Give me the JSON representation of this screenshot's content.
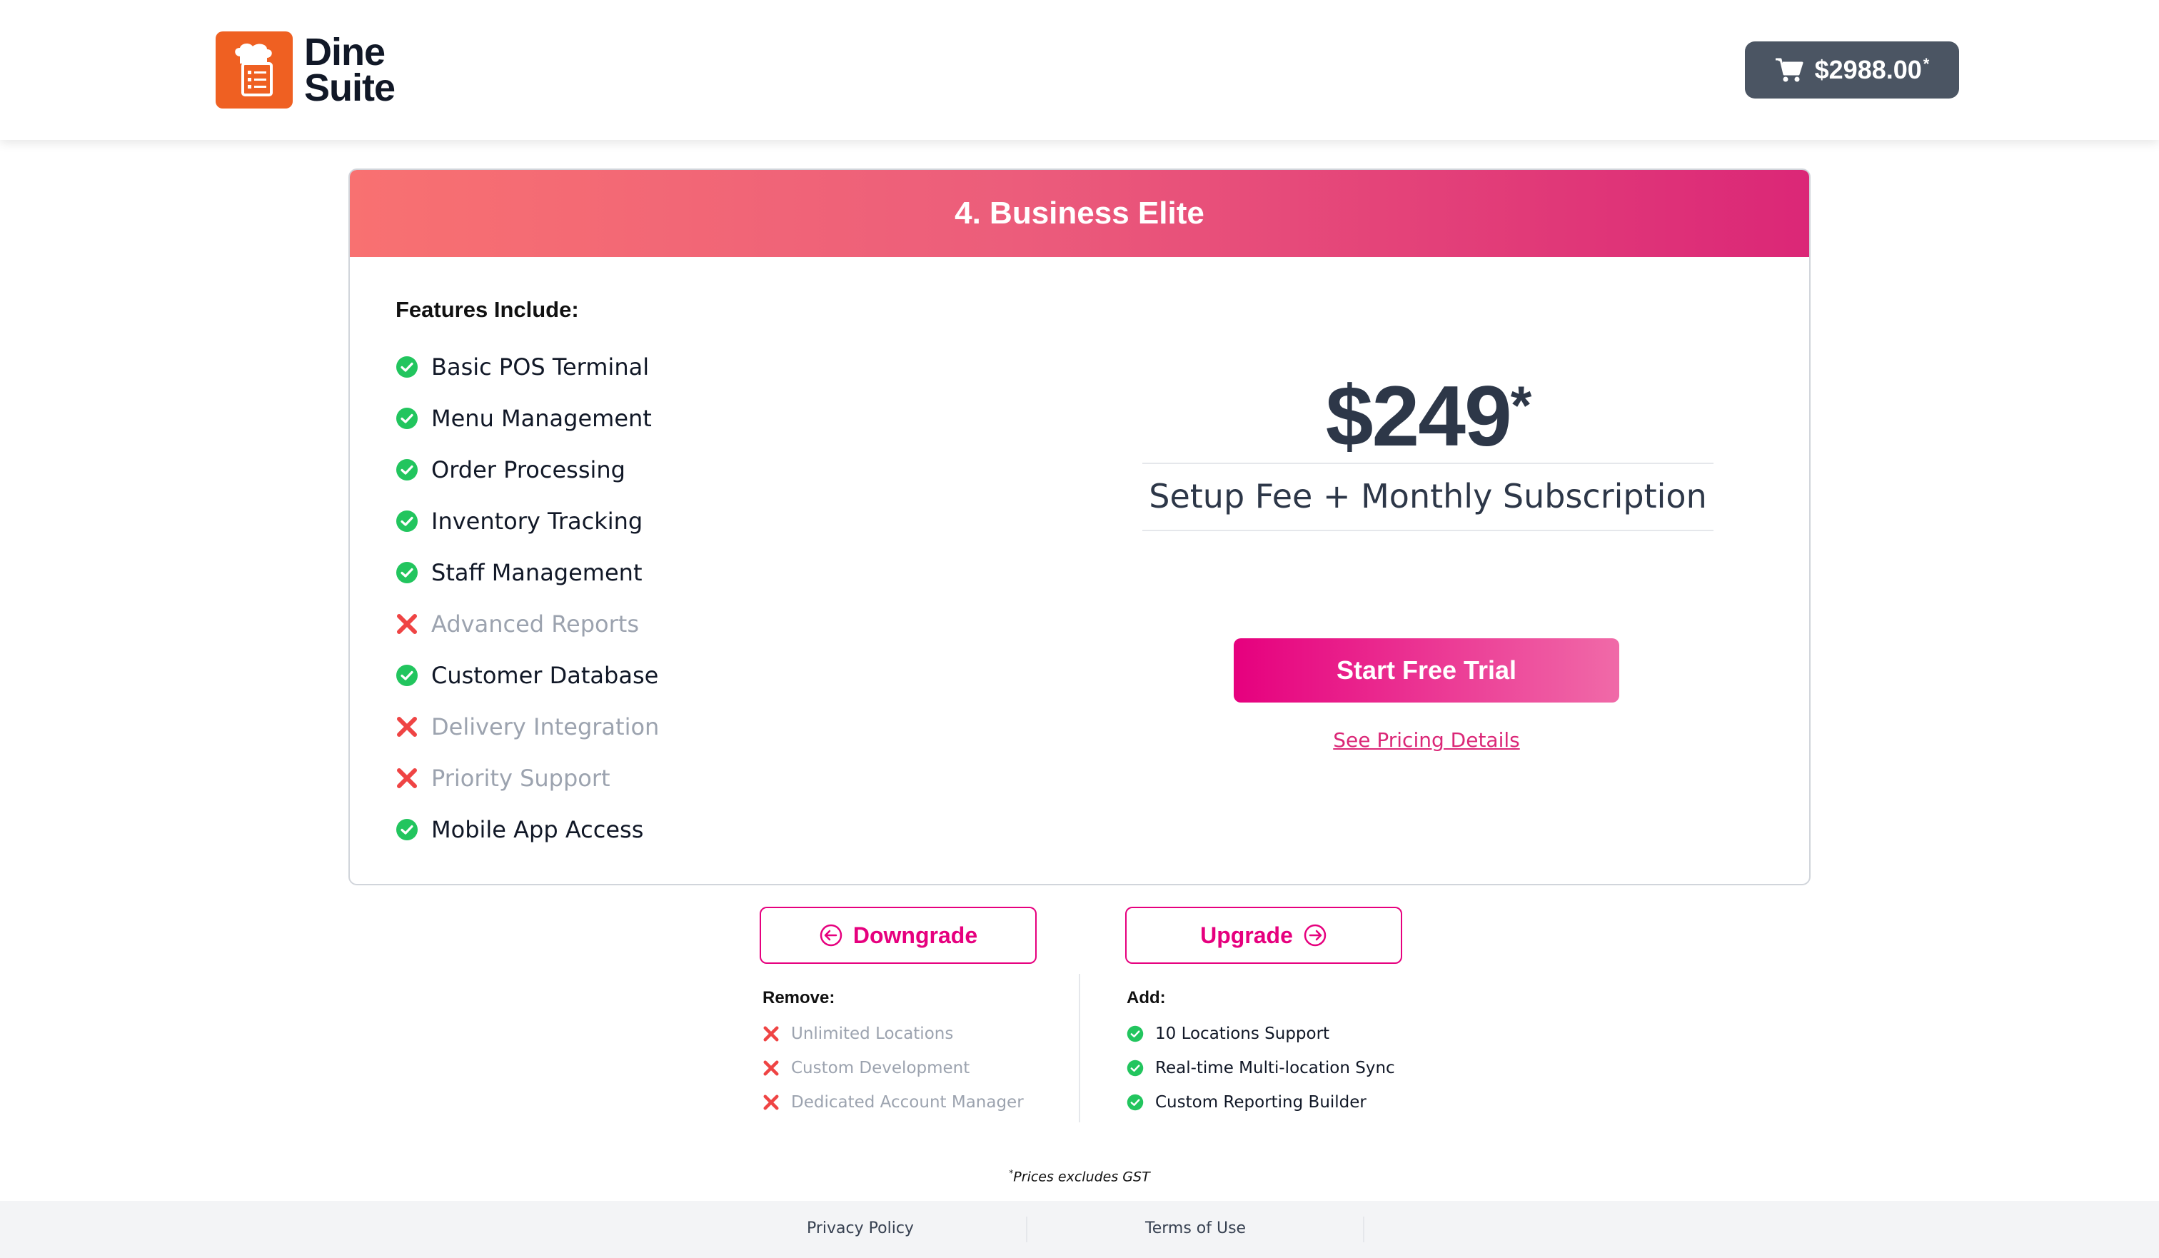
{
  "brand": {
    "logo_text_line1": "Dine",
    "logo_text_line2": "Suite",
    "accent_color": "#ef6022",
    "icon": "chef-clipboard-icon"
  },
  "header": {
    "cart_total": "$2988.00",
    "cart_asterisk": "*",
    "cart_icon": "cart-icon"
  },
  "plan": {
    "title": "4. Business Elite",
    "features_heading": "Features Include:",
    "features": [
      {
        "label": "Basic POS Terminal",
        "included": true
      },
      {
        "label": "Menu Management",
        "included": true
      },
      {
        "label": "Order Processing",
        "included": true
      },
      {
        "label": "Inventory Tracking",
        "included": true
      },
      {
        "label": "Staff Management",
        "included": true
      },
      {
        "label": "Advanced Reports",
        "included": false
      },
      {
        "label": "Customer Database",
        "included": true
      },
      {
        "label": "Delivery Integration",
        "included": false
      },
      {
        "label": "Priority Support",
        "included": false
      },
      {
        "label": "Mobile App Access",
        "included": true
      }
    ],
    "price": "$249",
    "price_asterisk": "*",
    "price_subtitle": "Setup Fee + Monthly Subscription",
    "trial_button": "Start Free Trial",
    "pricing_link": "See Pricing Details",
    "gradient_start": "#f87171",
    "gradient_end": "#db2777"
  },
  "navigation": {
    "downgrade_label": "Downgrade",
    "upgrade_label": "Upgrade",
    "accent_color": "#e6007e"
  },
  "changes": {
    "remove_title": "Remove:",
    "remove_items": [
      "Unlimited Locations",
      "Custom Development",
      "Dedicated Account Manager"
    ],
    "add_title": "Add:",
    "add_items": [
      "10 Locations Support",
      "Real-time Multi-location Sync",
      "Custom Reporting Builder"
    ]
  },
  "footnote": {
    "asterisk": "*",
    "text": "Prices excludes GST"
  },
  "footer": {
    "privacy": "Privacy Policy",
    "terms": "Terms of Use"
  },
  "colors": {
    "check_green": "#22c55e",
    "cross_red": "#ef4444",
    "muted_text": "#9ca3af"
  }
}
